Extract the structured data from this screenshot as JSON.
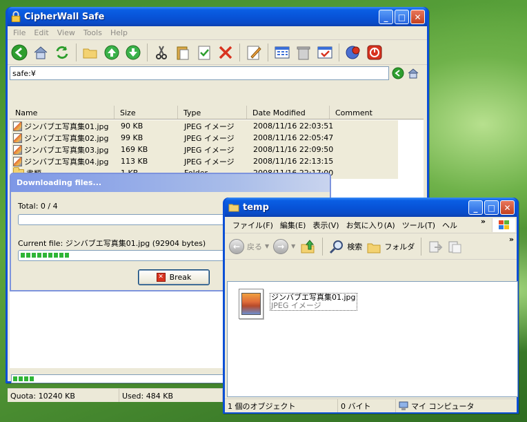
{
  "main": {
    "title": "CipherWall Safe",
    "menu": [
      "File",
      "Edit",
      "View",
      "Tools",
      "Help"
    ],
    "address": "safe:¥",
    "columns": [
      "Name",
      "Size",
      "Type",
      "Date Modified",
      "Comment"
    ],
    "files": [
      {
        "name": "ジンバブエ写真集01.jpg",
        "size": "90 KB",
        "type": "JPEG イメージ",
        "date": "2008/11/16 22:03:51",
        "kind": "file"
      },
      {
        "name": "ジンバブエ写真集02.jpg",
        "size": "99 KB",
        "type": "JPEG イメージ",
        "date": "2008/11/16 22:05:47",
        "kind": "file"
      },
      {
        "name": "ジンバブエ写真集03.jpg",
        "size": "169 KB",
        "type": "JPEG イメージ",
        "date": "2008/11/16 22:09:50",
        "kind": "file"
      },
      {
        "name": "ジンバブエ写真集04.jpg",
        "size": "113 KB",
        "type": "JPEG イメージ",
        "date": "2008/11/16 22:13:15",
        "kind": "file"
      },
      {
        "name": "書類",
        "size": "1 KB",
        "type": "Folder",
        "date": "2008/11/16 22:17:00",
        "kind": "folder"
      }
    ],
    "status": {
      "quota": "Quota: 10240 KB",
      "used": "Used: 484 KB"
    }
  },
  "download": {
    "title": "Downloading files...",
    "total": "Total: 0 / 4",
    "current": "Current file: ジンバブエ写真集01.jpg (92904 bytes)",
    "break_label": "Break",
    "current_progress": 0.16
  },
  "temp": {
    "title": "temp",
    "menu": [
      "ファイル(F)",
      "編集(E)",
      "表示(V)",
      "お気に入り(A)",
      "ツール(T)",
      "ヘル"
    ],
    "back_label": "戻る",
    "search_label": "検索",
    "folders_label": "フォルダ",
    "file_name": "ジンバブエ写真集01.jpg",
    "file_type": "JPEG イメージ",
    "status": {
      "objects": "1 個のオブジェクト",
      "size": "0 バイト",
      "location": "マイ コンピュータ"
    }
  }
}
